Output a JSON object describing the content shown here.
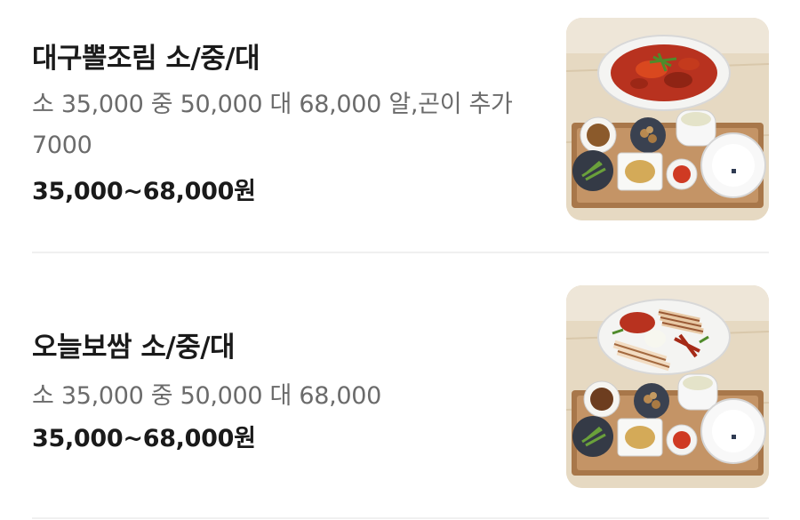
{
  "menu": {
    "items": [
      {
        "name": "대구뽈조림 소/중/대",
        "description": "소 35,000 중 50,000 대 68,000 알,곤이 추가 7000",
        "price": "35,000~68,000원",
        "photo_icon": "braised-cod-set-photo"
      },
      {
        "name": "오늘보쌈 소/중/대",
        "description": "소 35,000 중 50,000 대 68,000",
        "price": "35,000~68,000원",
        "photo_icon": "bossam-set-photo"
      }
    ]
  },
  "colors": {
    "title_text": "#1a1a1a",
    "description_text": "#6b6b6b",
    "divider": "#f0f0f0",
    "braise_sauce": "#b8321f"
  }
}
